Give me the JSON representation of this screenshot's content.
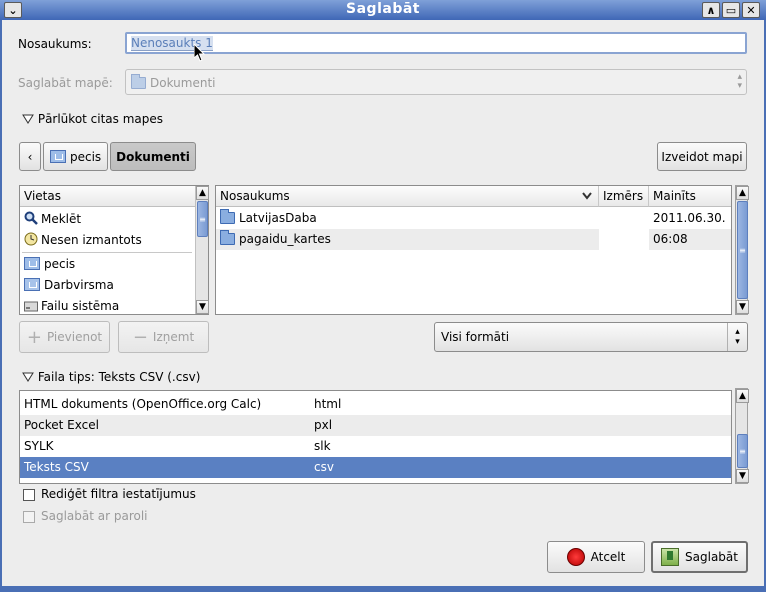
{
  "window": {
    "title": "Saglabāt"
  },
  "name_field": {
    "label": "Nosaukums:",
    "value": "Nenosaukts 1"
  },
  "save_in": {
    "label": "Saglabāt mapē:",
    "value": "Dokumenti"
  },
  "browse_toggle": {
    "label": "Pārlūkot citas mapes"
  },
  "path_bar": {
    "back_label": "‹",
    "crumbs": [
      "pecis",
      "Dokumenti"
    ],
    "create_folder_label": "Izveidot mapi"
  },
  "places": {
    "header": "Vietas",
    "items": [
      "Meklēt",
      "Nesen izmantots",
      "pecis",
      "Darbvirsma",
      "Failu sistēma"
    ]
  },
  "files": {
    "columns": [
      "Nosaukums",
      "Izmērs",
      "Mainīts"
    ],
    "rows": [
      {
        "name": "LatvijasDaba",
        "size": "",
        "modified": "2011.06.30."
      },
      {
        "name": "pagaidu_kartes",
        "size": "",
        "modified": "06:08"
      }
    ]
  },
  "place_buttons": {
    "add": "Pievienot",
    "remove": "Izņemt"
  },
  "format_filter": {
    "value": "Visi formāti"
  },
  "file_type": {
    "label": "Faila tips: Teksts CSV (.csv)",
    "rows": [
      {
        "name": "HTML dokuments (OpenOffice.org Calc)",
        "ext": "html"
      },
      {
        "name": "Pocket Excel",
        "ext": "pxl"
      },
      {
        "name": "SYLK",
        "ext": "slk"
      },
      {
        "name": "Teksts CSV",
        "ext": "csv"
      }
    ]
  },
  "options": {
    "edit_filter": "Rediģēt filtra iestatījumus",
    "password": "Saglabāt ar paroli"
  },
  "actions": {
    "cancel": "Atcelt",
    "save": "Saglabāt"
  }
}
